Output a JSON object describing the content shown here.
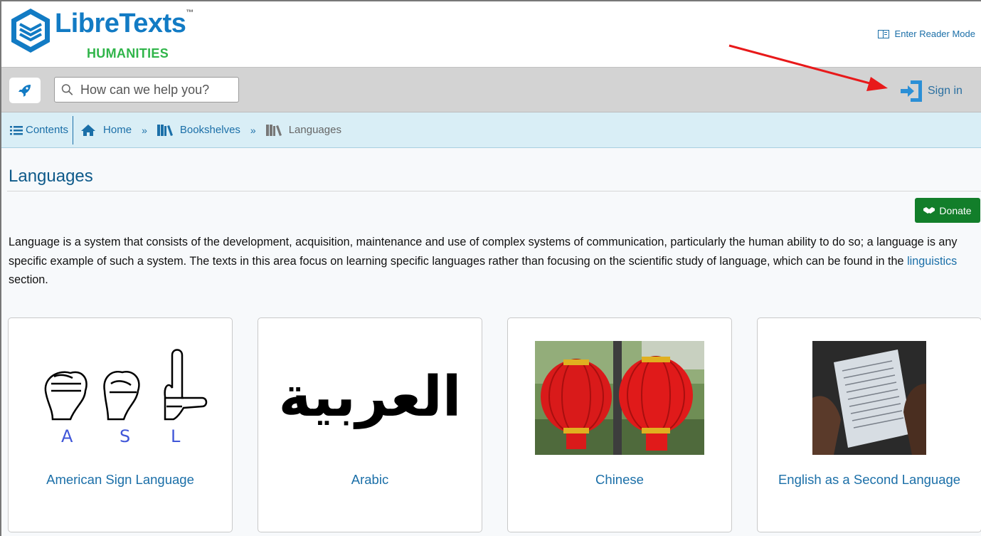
{
  "header": {
    "logo_word": "LibreTexts",
    "logo_tm": "™",
    "logo_sub": "HUMANITIES",
    "reader_mode": "Enter Reader Mode"
  },
  "search": {
    "placeholder": "How can we help you?",
    "sign_in": "Sign in"
  },
  "breadcrumb": {
    "contents": "Contents",
    "items": [
      "Home",
      "Bookshelves",
      "Languages"
    ],
    "separator": "»"
  },
  "page": {
    "title": "Languages",
    "donate": "Donate",
    "description_before": "Language is a system that consists of the development, acquisition, maintenance and use of complex systems of communication, particularly the human ability to do so; a language is any specific example of such a system. The texts in this area focus on learning specific languages rather than focusing on the scientific study of language, which can be found in the ",
    "description_link": "linguistics",
    "description_after": " section."
  },
  "cards": [
    {
      "label": "American Sign Language",
      "image_text": "A S L"
    },
    {
      "label": "Arabic",
      "image_text": "العربية"
    },
    {
      "label": "Chinese"
    },
    {
      "label": "English as a Second Language"
    }
  ],
  "colors": {
    "link": "#1b6fa8",
    "donate": "#127e2a",
    "breadcrumb_bg": "#d9eef6",
    "search_bar_bg": "#d3d3d3",
    "logo_blue": "#127bc4",
    "logo_green": "#30b54a",
    "annotation_arrow": "#e8191a"
  },
  "icons": [
    "libretexts-logo-icon",
    "reader-mode-icon",
    "rocket-icon",
    "search-icon",
    "sign-in-icon",
    "list-icon",
    "home-icon",
    "bookshelf-icon",
    "donate-handshake-icon"
  ]
}
